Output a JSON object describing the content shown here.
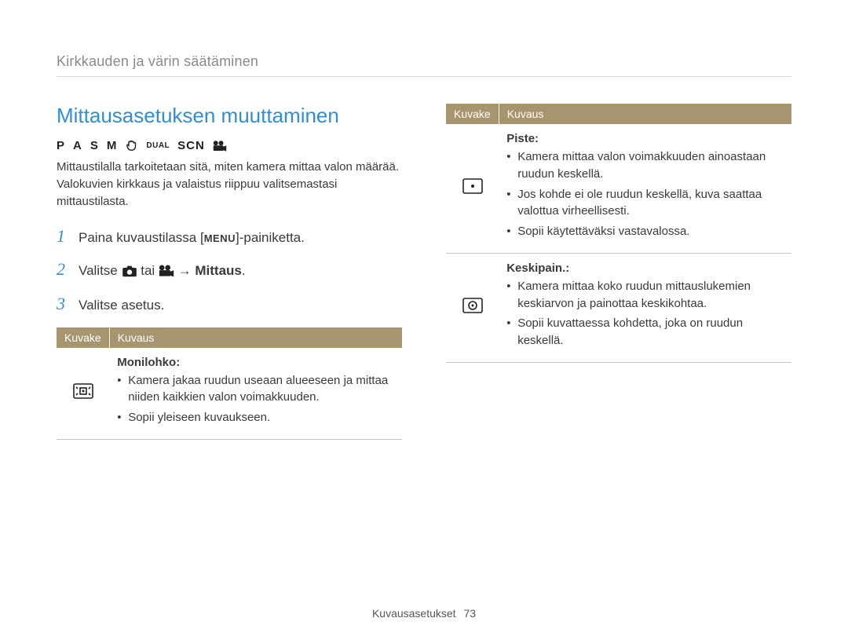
{
  "breadcrumb": "Kirkkauden ja värin säätäminen",
  "heading": "Mittausasetuksen muuttaminen",
  "modes": {
    "p": "P",
    "a": "A",
    "s": "S",
    "m": "M",
    "dual": "DUAL",
    "scn": "SCN"
  },
  "intro": "Mittaustilalla tarkoitetaan sitä, miten kamera mittaa valon määrää. Valokuvien kirkkaus ja valaistus riippuu valitsemastasi mittaustilasta.",
  "steps": {
    "s1_a": "Paina kuvaustilassa [",
    "s1_menu": "MENU",
    "s1_b": "]-painiketta.",
    "s2_a": "Valitse ",
    "s2_b": " tai ",
    "s2_arrow": " → ",
    "s2_c": "Mittaus",
    "s2_d": ".",
    "s3": "Valitse asetus."
  },
  "table_headers": {
    "icon": "Kuvake",
    "desc": "Kuvaus"
  },
  "rows_left": [
    {
      "icon": "multi",
      "title": "Monilohko:",
      "bullets": [
        "Kamera jakaa ruudun useaan alueeseen ja mittaa niiden kaikkien valon voimakkuuden.",
        "Sopii yleiseen kuvaukseen."
      ]
    }
  ],
  "rows_right": [
    {
      "icon": "spot",
      "title": "Piste:",
      "bullets": [
        "Kamera mittaa valon voimakkuuden ainoastaan ruudun keskellä.",
        "Jos kohde ei ole ruudun keskellä, kuva saattaa valottua virheellisesti.",
        "Sopii käytettäväksi vastavalossa."
      ]
    },
    {
      "icon": "center",
      "title": "Keskipain.:",
      "bullets": [
        "Kamera mittaa koko ruudun mittauslukemien keskiarvon ja painottaa keskikohtaa.",
        "Sopii kuvattaessa kohdetta, joka on ruudun keskellä."
      ]
    }
  ],
  "footer": {
    "section": "Kuvausasetukset",
    "page": "73"
  }
}
